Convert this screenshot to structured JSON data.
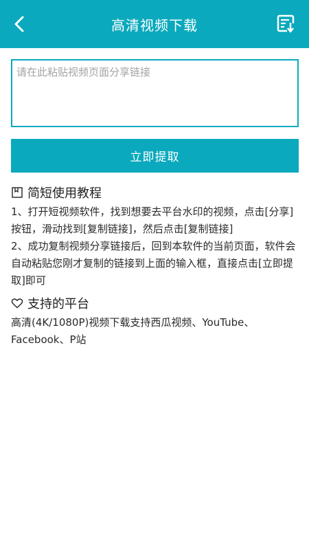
{
  "header": {
    "title": "高清视频下载",
    "back_icon": "back-chevron-icon",
    "download_icon": "download-list-icon"
  },
  "input": {
    "placeholder": "请在此粘贴视频页面分享链接",
    "value": ""
  },
  "button": {
    "label": "立即提取"
  },
  "tutorial": {
    "icon": "book-icon",
    "title": "简短使用教程",
    "steps": [
      "1、打开短视频软件，找到想要去平台水印的视频，点击[分享]按钮，滑动找到[复制链接]，然后点击[复制链接]",
      "2、成功复制视频分享链接后，回到本软件的当前页面，软件会自动粘贴您刚才复制的链接到上面的输入框，直接点击[立即提取]即可"
    ]
  },
  "platforms": {
    "icon": "heart-icon",
    "title": "支持的平台",
    "text": "高清(4K/1080P)视频下载支持西瓜视频、YouTube、Facebook、P站"
  },
  "colors": {
    "accent": "#0aa9bd",
    "placeholder": "#a3a3a3"
  }
}
